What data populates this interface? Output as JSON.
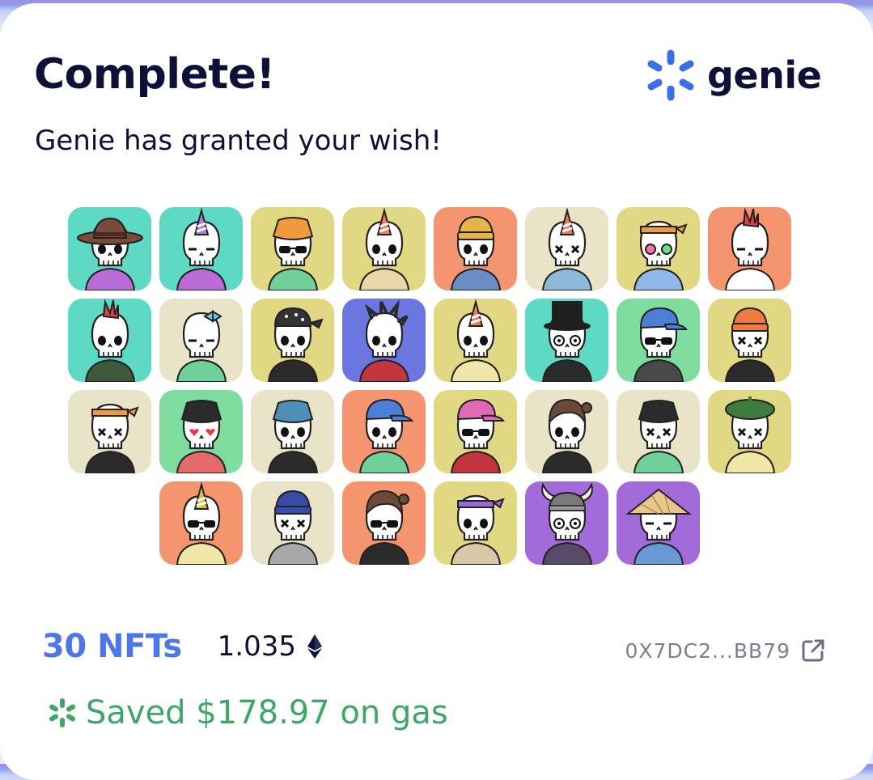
{
  "header": {
    "title": "Complete!",
    "subtitle": "Genie has granted your wish!",
    "logo_text": "genie",
    "logo_icon": "genie-star-logo-icon",
    "logo_color": "#3a6fe5"
  },
  "nfts": [
    {
      "bg": "#5ed9c3",
      "hat": "cowboy",
      "hat_color": "#7a4a3a",
      "shirt": "#b96bd6",
      "eyes": "dots"
    },
    {
      "bg": "#5ed9c3",
      "hat": "party",
      "hat_color": "#b57be0",
      "shirt": "#b96bd6",
      "eyes": "sleepy"
    },
    {
      "bg": "#e0d882",
      "hat": "bucket",
      "hat_color": "#f09a3e",
      "shirt": "#6fd09a",
      "eyes": "shades"
    },
    {
      "bg": "#e0d882",
      "hat": "party",
      "hat_color": "#f27b5e",
      "shirt": "#e8d8a8",
      "eyes": "dots"
    },
    {
      "bg": "#f4956f",
      "hat": "beanie",
      "hat_color": "#e7b34a",
      "shirt": "#6a8dc7",
      "eyes": "dots"
    },
    {
      "bg": "#e9e3c7",
      "hat": "party",
      "hat_color": "#f27b5e",
      "shirt": "#8fb8d8",
      "eyes": "x"
    },
    {
      "bg": "#e0d882",
      "hat": "headband",
      "hat_color": "#f09a3e",
      "shirt": "#8fb8e8",
      "eyes": "glasses"
    },
    {
      "bg": "#f4956f",
      "hat": "mohawk",
      "hat_color": "#e53b4a",
      "shirt": "#ffffff",
      "eyes": "sleepy"
    },
    {
      "bg": "#5ed9c3",
      "hat": "mohawk",
      "hat_color": "#e53b4a",
      "shirt": "#3f5a3a",
      "eyes": "dots"
    },
    {
      "bg": "#e9e3c7",
      "hat": "bow",
      "hat_color": "#6fc6e8",
      "shirt": "#6fd09a",
      "eyes": "sleepy"
    },
    {
      "bg": "#e0d882",
      "hat": "bandana",
      "hat_color": "#333333",
      "shirt": "#2b2b2b",
      "eyes": "dots"
    },
    {
      "bg": "#6b76e0",
      "hat": "spikes",
      "hat_color": "#2b2b2b",
      "shirt": "#c2353f",
      "eyes": "dots"
    },
    {
      "bg": "#e0d882",
      "hat": "party",
      "hat_color": "#f27b5e",
      "shirt": "#f0e6a8",
      "eyes": "dots"
    },
    {
      "bg": "#5ed9c3",
      "hat": "tophat",
      "hat_color": "#1f1f1f",
      "shirt": "#2b2b2b",
      "eyes": "spiral"
    },
    {
      "bg": "#7ddc9e",
      "hat": "cap",
      "hat_color": "#4d7fd6",
      "shirt": "#4a4a4a",
      "eyes": "shades"
    },
    {
      "bg": "#e0d882",
      "hat": "beanie",
      "hat_color": "#f07b3e",
      "shirt": "#2b2b2b",
      "eyes": "x"
    },
    {
      "bg": "#e9e3c7",
      "hat": "headband",
      "hat_color": "#f09a3e",
      "shirt": "#2b2b2b",
      "eyes": "x"
    },
    {
      "bg": "#7ddc9e",
      "hat": "bucket",
      "hat_color": "#2b2b2b",
      "shirt": "#e56a6a",
      "eyes": "hearts"
    },
    {
      "bg": "#e9e3c7",
      "hat": "bucket",
      "hat_color": "#4d8fb8",
      "shirt": "#2b2b2b",
      "eyes": "dots"
    },
    {
      "bg": "#f4956f",
      "hat": "cap",
      "hat_color": "#4d7fd6",
      "shirt": "#6fd09a",
      "eyes": "dots"
    },
    {
      "bg": "#e0d882",
      "hat": "cap",
      "hat_color": "#e06ab8",
      "shirt": "#c2353f",
      "eyes": "shades"
    },
    {
      "bg": "#e9e3c7",
      "hat": "hair",
      "hat_color": "#6b4a3a",
      "shirt": "#2b2b2b",
      "eyes": "dots"
    },
    {
      "bg": "#e9e3c7",
      "hat": "bucket",
      "hat_color": "#2b2b2b",
      "shirt": "#6fd09a",
      "eyes": "x"
    },
    {
      "bg": "#e0d882",
      "hat": "beret",
      "hat_color": "#3f7a3f",
      "shirt": "#f0e6a8",
      "eyes": "x"
    },
    {
      "bg": "#f4956f",
      "hat": "party",
      "hat_color": "#e0c040",
      "shirt": "#f0e6a8",
      "eyes": "shades"
    },
    {
      "bg": "#e9e3c7",
      "hat": "beanie",
      "hat_color": "#3a4aa8",
      "shirt": "#a8a8a8",
      "eyes": "x"
    },
    {
      "bg": "#f4956f",
      "hat": "hair",
      "hat_color": "#6b4a3a",
      "shirt": "#2b2b2b",
      "eyes": "shades"
    },
    {
      "bg": "#e0d882",
      "hat": "headband",
      "hat_color": "#9b6ad6",
      "shirt": "#d8c8a8",
      "eyes": "dots"
    },
    {
      "bg": "#a36ad9",
      "hat": "viking",
      "hat_color": "#7a7a7a",
      "shirt": "#5a4a6a",
      "eyes": "spiral"
    },
    {
      "bg": "#a36ad9",
      "hat": "conical",
      "hat_color": "#e8c88a",
      "shirt": "#6a9ad6",
      "eyes": "sleepy"
    }
  ],
  "summary": {
    "count_label": "30 NFTs",
    "price": "1.035",
    "currency_icon": "ethereum-icon",
    "address": "0X7DC2...BB79",
    "external_link_icon": "external-link-icon",
    "saved_label": "Saved $178.97 on gas",
    "saved_icon": "gas-badge-icon",
    "count_color": "#4d77e6",
    "saved_color": "#3ea766"
  }
}
